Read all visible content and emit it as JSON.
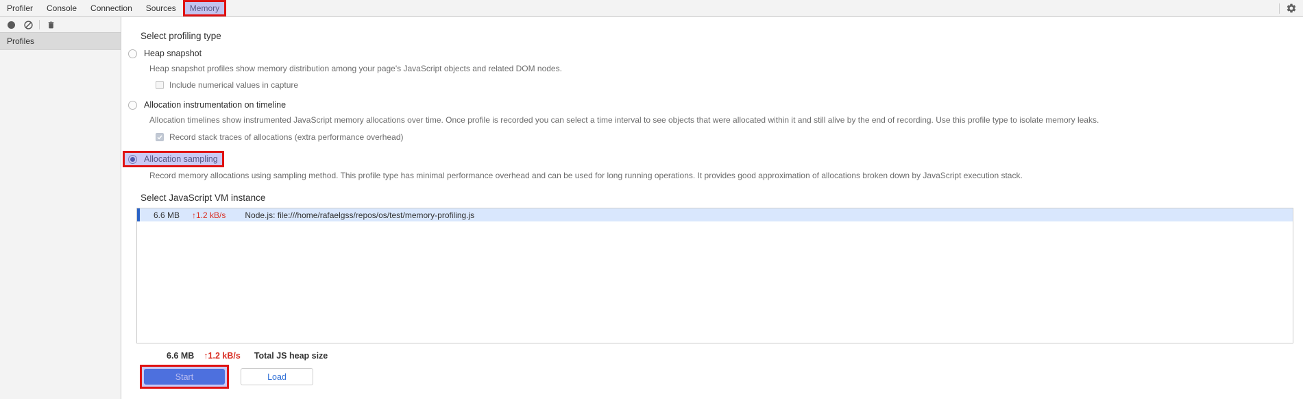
{
  "colors": {
    "chrome-bg": "#f3f3f3",
    "sidebar-header-bg": "#dadada",
    "border": "#cccccc",
    "text": "#333333",
    "muted": "#6c6c6c",
    "rate-red": "#d93025",
    "row-bg": "#d9e7fd",
    "row-accent": "#2b63c6",
    "start-blue": "#1d5cd6",
    "load-blue": "#2f6fd6",
    "annot-red": "#e01212",
    "annot-fill": "rgba(138,138,232,0.45)"
  },
  "tabs": [
    {
      "label": "Profiler"
    },
    {
      "label": "Console"
    },
    {
      "label": "Connection"
    },
    {
      "label": "Sources"
    },
    {
      "label": "Memory",
      "active": true
    }
  ],
  "toolbar_icons": [
    {
      "name": "record-icon"
    },
    {
      "name": "clear-icon"
    },
    {
      "name": "delete-icon"
    }
  ],
  "sidebar": {
    "profiles_header": "Profiles"
  },
  "profiling": {
    "heading": "Select profiling type",
    "options": [
      {
        "label": "Heap snapshot",
        "selected": false,
        "description": "Heap snapshot profiles show memory distribution among your page's JavaScript objects and related DOM nodes.",
        "checkbox": {
          "label": "Include numerical values in capture",
          "checked": false
        }
      },
      {
        "label": "Allocation instrumentation on timeline",
        "selected": false,
        "description": "Allocation timelines show instrumented JavaScript memory allocations over time. Once profile is recorded you can select a time interval to see objects that were allocated within it and still alive by the end of recording. Use this profile type to isolate memory leaks.",
        "checkbox": {
          "label": "Record stack traces of allocations (extra performance overhead)",
          "checked": true
        }
      },
      {
        "label": "Allocation sampling",
        "selected": true,
        "description": "Record memory allocations using sampling method. This profile type has minimal performance overhead and can be used for long running operations. It provides good approximation of allocations broken down by JavaScript execution stack."
      }
    ]
  },
  "vm": {
    "heading": "Select JavaScript VM instance",
    "instances": [
      {
        "heap_size": "6.6 MB",
        "rate": "↑1.2 kB/s",
        "name": "Node.js: file:///home/rafaelgss/repos/os/test/memory-profiling.js"
      }
    ],
    "total": {
      "heap_size": "6.6 MB",
      "rate": "↑1.2 kB/s",
      "label": "Total JS heap size"
    }
  },
  "actions": {
    "start": "Start",
    "load": "Load"
  }
}
